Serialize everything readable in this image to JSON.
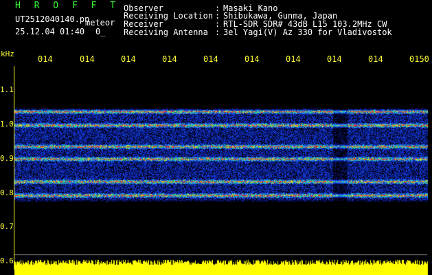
{
  "header": {
    "brand": "H R O F F T",
    "filename": "UT2512040140.pn",
    "mode": "meteor",
    "date_time": "25.12.04 01:40",
    "counter": "0_",
    "meta": [
      {
        "label": "Observer",
        "value": "Masaki Kano"
      },
      {
        "label": "Receiving Location",
        "value": "Shibukawa, Gunma, Japan"
      },
      {
        "label": "Receiver",
        "value": "RTL-SDR SDR# 43dB L15 103.2MHz CW"
      },
      {
        "label": "Receiving Antenna",
        "value": "3el Yagi(V) Az 330 for Vladivostok"
      }
    ]
  },
  "axes": {
    "freq_unit": "kHz",
    "time_ticks": [
      "014",
      "014",
      "014",
      "014",
      "014",
      "014",
      "014",
      "014",
      "014",
      "0150"
    ],
    "freq_ticks": [
      "1.1",
      "1.0",
      "0.9",
      "0.8",
      "0.7",
      "0.6"
    ]
  },
  "colors": {
    "label": "#ffffff",
    "value": "#ffff33",
    "brand": "#33ff33",
    "baseline": "#ffff00"
  }
}
